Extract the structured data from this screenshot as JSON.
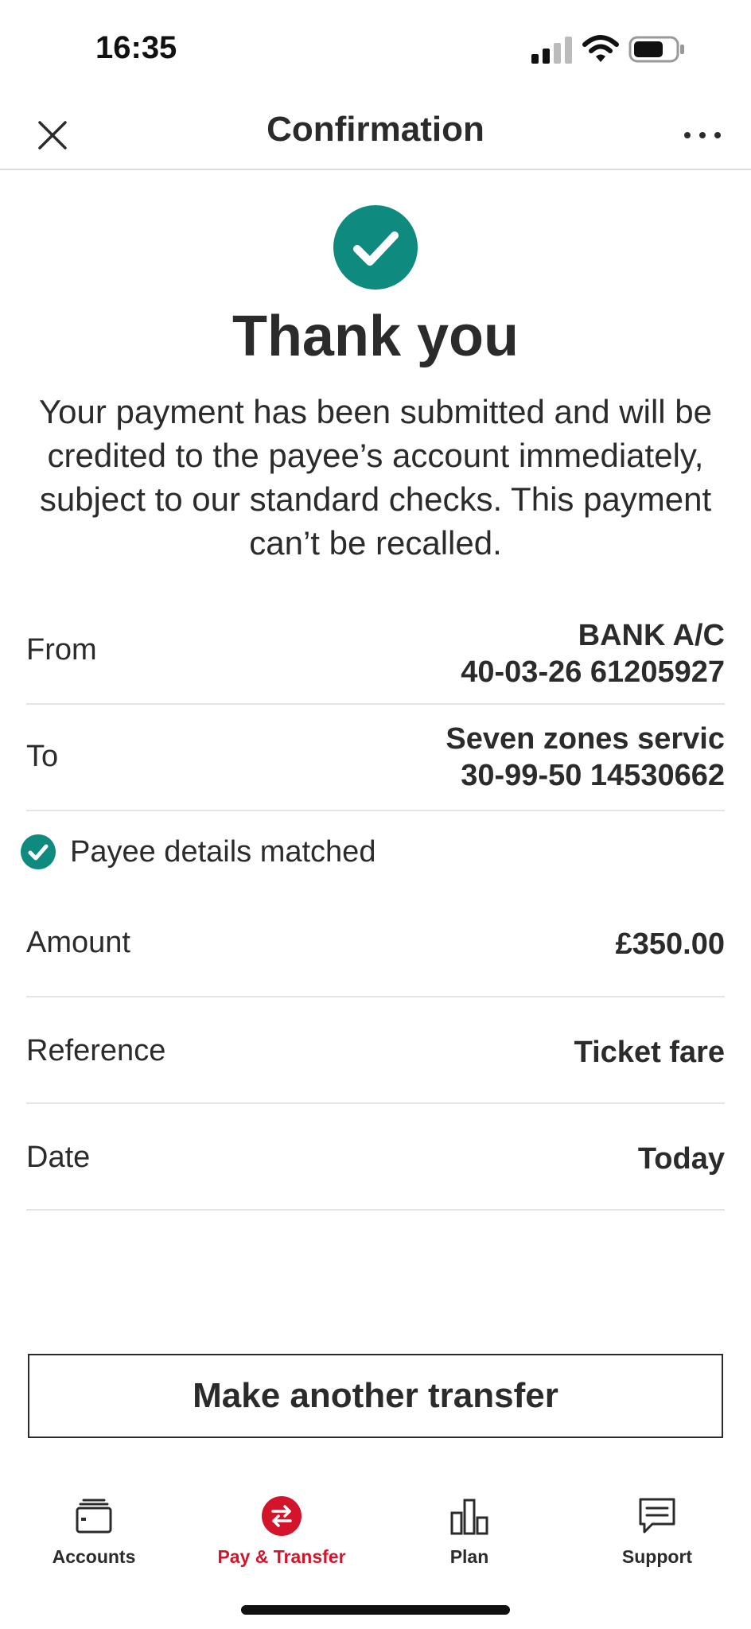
{
  "status_bar": {
    "time": "16:35"
  },
  "header": {
    "title": "Confirmation"
  },
  "success": {
    "title": "Thank you",
    "message": "Your payment has been submitted and will be credited to the payee’s account immediately, subject to our standard checks. This payment can’t be recalled."
  },
  "details": {
    "from": {
      "label": "From",
      "line1": "BANK A/C",
      "line2": "40-03-26 61205927"
    },
    "to": {
      "label": "To",
      "line1": "Seven zones servic",
      "line2": "30-99-50 14530662"
    },
    "payee_match": "Payee details matched",
    "amount": {
      "label": "Amount",
      "value": "£350.00"
    },
    "reference": {
      "label": "Reference",
      "value": "Ticket fare"
    },
    "date": {
      "label": "Date",
      "value": "Today"
    }
  },
  "actions": {
    "make_another_transfer": "Make another transfer"
  },
  "tabs": [
    {
      "label": "Accounts",
      "icon": "wallet-icon",
      "active": false
    },
    {
      "label": "Pay & Transfer",
      "icon": "transfer-icon",
      "active": true
    },
    {
      "label": "Plan",
      "icon": "bar-chart-icon",
      "active": false
    },
    {
      "label": "Support",
      "icon": "chat-bubble-icon",
      "active": false
    }
  ],
  "colors": {
    "success": "#0e8a7e",
    "accent": "#d4142a",
    "text": "#2b2b2b"
  }
}
